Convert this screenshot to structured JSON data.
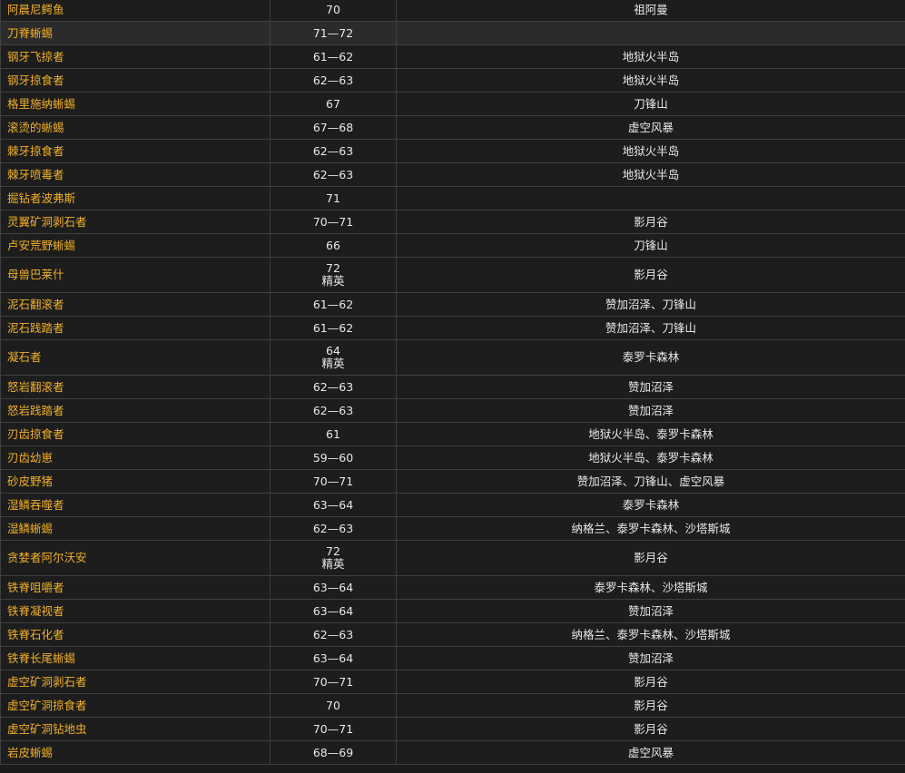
{
  "creatures": [
    {
      "name": "阿晨尼鳄鱼",
      "level": "70",
      "tag": "",
      "zone": "祖阿曼"
    },
    {
      "name": "刀脊蜥蜴",
      "level": "71—72",
      "tag": "",
      "zone": ""
    },
    {
      "name": "钢牙飞掠者",
      "level": "61—62",
      "tag": "",
      "zone": "地狱火半岛"
    },
    {
      "name": "钢牙掠食者",
      "level": "62—63",
      "tag": "",
      "zone": "地狱火半岛"
    },
    {
      "name": "格里施纳蜥蜴",
      "level": "67",
      "tag": "",
      "zone": "刀锋山"
    },
    {
      "name": "滚烫的蜥蜴",
      "level": "67—68",
      "tag": "",
      "zone": "虚空风暴"
    },
    {
      "name": "棘牙掠食者",
      "level": "62—63",
      "tag": "",
      "zone": "地狱火半岛"
    },
    {
      "name": "棘牙喷毒者",
      "level": "62—63",
      "tag": "",
      "zone": "地狱火半岛"
    },
    {
      "name": "掘钻者波弗斯",
      "level": "71",
      "tag": "",
      "zone": ""
    },
    {
      "name": "灵翼矿洞剥石者",
      "level": "70—71",
      "tag": "",
      "zone": "影月谷"
    },
    {
      "name": "卢安荒野蜥蜴",
      "level": "66",
      "tag": "",
      "zone": "刀锋山"
    },
    {
      "name": "母兽巴莱什",
      "level": "72",
      "tag": "精英",
      "zone": "影月谷"
    },
    {
      "name": "泥石翻滚者",
      "level": "61—62",
      "tag": "",
      "zone": "赞加沼泽、刀锋山"
    },
    {
      "name": "泥石践踏者",
      "level": "61—62",
      "tag": "",
      "zone": "赞加沼泽、刀锋山"
    },
    {
      "name": "凝石者",
      "level": "64",
      "tag": "精英",
      "zone": "泰罗卡森林"
    },
    {
      "name": "怒岩翻滚者",
      "level": "62—63",
      "tag": "",
      "zone": "赞加沼泽"
    },
    {
      "name": "怒岩践踏者",
      "level": "62—63",
      "tag": "",
      "zone": "赞加沼泽"
    },
    {
      "name": "刃齿掠食者",
      "level": "61",
      "tag": "",
      "zone": "地狱火半岛、泰罗卡森林"
    },
    {
      "name": "刃齿幼崽",
      "level": "59—60",
      "tag": "",
      "zone": "地狱火半岛、泰罗卡森林"
    },
    {
      "name": "砂皮野猪",
      "level": "70—71",
      "tag": "",
      "zone": "赞加沼泽、刀锋山、虚空风暴"
    },
    {
      "name": "湿鳞吞噬者",
      "level": "63—64",
      "tag": "",
      "zone": "泰罗卡森林"
    },
    {
      "name": "湿鳞蜥蜴",
      "level": "62—63",
      "tag": "",
      "zone": "纳格兰、泰罗卡森林、沙塔斯城"
    },
    {
      "name": "贪婪者阿尔沃安",
      "level": "72",
      "tag": "精英",
      "zone": "影月谷"
    },
    {
      "name": "铁脊咀嚼者",
      "level": "63—64",
      "tag": "",
      "zone": "泰罗卡森林、沙塔斯城"
    },
    {
      "name": "铁脊凝视者",
      "level": "63—64",
      "tag": "",
      "zone": "赞加沼泽"
    },
    {
      "name": "铁脊石化者",
      "level": "62—63",
      "tag": "",
      "zone": "纳格兰、泰罗卡森林、沙塔斯城"
    },
    {
      "name": "铁脊长尾蜥蜴",
      "level": "63—64",
      "tag": "",
      "zone": "赞加沼泽"
    },
    {
      "name": "虚空矿洞剥石者",
      "level": "70—71",
      "tag": "",
      "zone": "影月谷"
    },
    {
      "name": "虚空矿洞掠食者",
      "level": "70",
      "tag": "",
      "zone": "影月谷"
    },
    {
      "name": "虚空矿洞钻地虫",
      "level": "70—71",
      "tag": "",
      "zone": "影月谷"
    },
    {
      "name": "岩皮蜥蜴",
      "level": "68—69",
      "tag": "",
      "zone": "虚空风暴"
    }
  ],
  "highlighted_row": 1
}
